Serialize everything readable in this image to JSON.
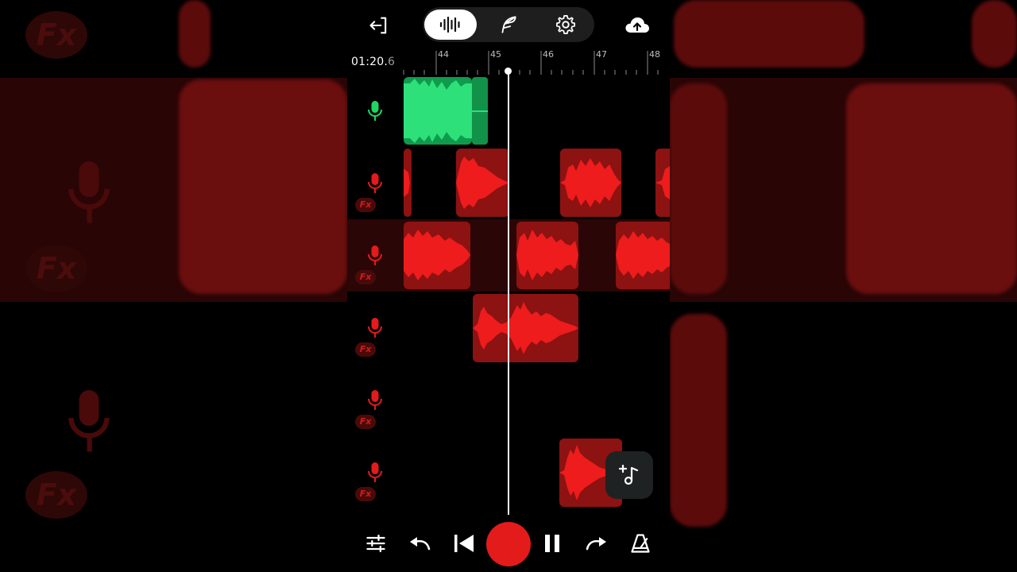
{
  "topbar": {
    "exit_icon": "exit-icon",
    "tabs": [
      {
        "icon": "waveform-icon",
        "active": true
      },
      {
        "icon": "feather-icon",
        "active": false
      },
      {
        "icon": "gear-icon",
        "active": false
      }
    ],
    "upload_icon": "cloud-upload-icon"
  },
  "timeline": {
    "timecode_main": "01:20.",
    "timecode_fraction": "6",
    "ruler_labels": [
      "44",
      "45",
      "46",
      "47",
      "48"
    ]
  },
  "tracks": [
    {
      "id": 1,
      "mic_color": "#1ed760",
      "fx_label": ""
    },
    {
      "id": 2,
      "mic_color": "#e31b1b",
      "fx_label": "Fx"
    },
    {
      "id": 3,
      "mic_color": "#e31b1b",
      "fx_label": "Fx"
    },
    {
      "id": 4,
      "mic_color": "#e31b1b",
      "fx_label": "Fx"
    },
    {
      "id": 5,
      "mic_color": "#e31b1b",
      "fx_label": "Fx"
    },
    {
      "id": 6,
      "mic_color": "#e31b1b",
      "fx_label": "Fx"
    }
  ],
  "background": {
    "fx_label": "Fx"
  },
  "bottombar": {
    "icons": [
      "mixer-sliders-icon",
      "undo-icon",
      "skip-to-start-icon",
      "record-button",
      "pause-icon",
      "redo-icon",
      "metronome-icon"
    ]
  },
  "fab_icon": "add-music-icon",
  "colors": {
    "accent_red": "#e31b1b",
    "clip_red": "#8d1212",
    "wave_red": "#ee1c1c",
    "accent_green": "#1ed760"
  }
}
